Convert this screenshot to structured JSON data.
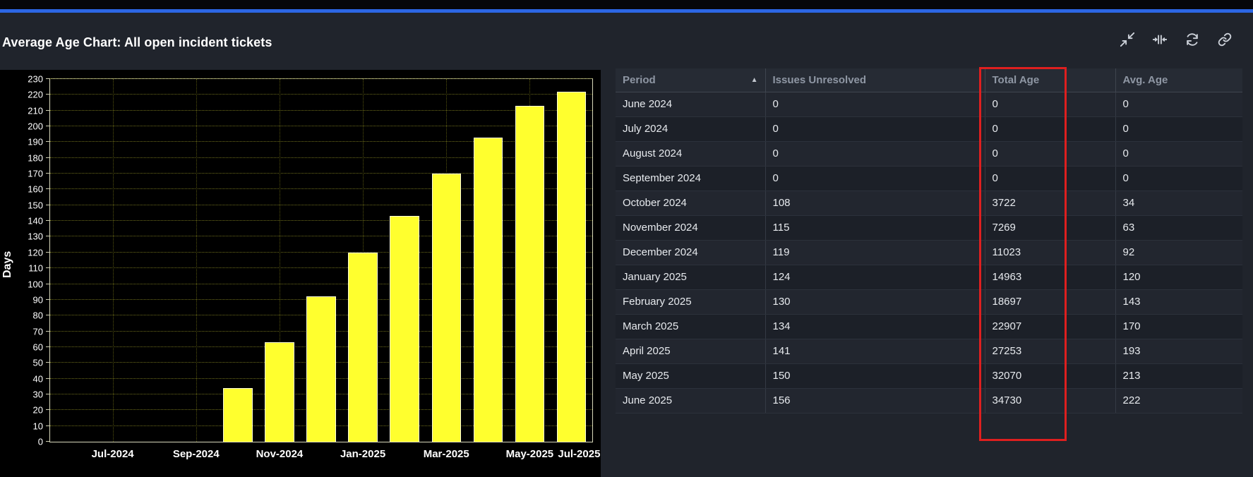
{
  "widget": {
    "title": "Average Age Chart: All open incident tickets"
  },
  "toolbar": {
    "buttons": [
      {
        "name": "collapse-icon",
        "action": "Collapse"
      },
      {
        "name": "fit-width-icon",
        "action": "Fit width"
      },
      {
        "name": "refresh-icon",
        "action": "Refresh"
      },
      {
        "name": "link-icon",
        "action": "Link"
      }
    ]
  },
  "chart_data": {
    "type": "bar",
    "title": "Average Age Chart: All open incident tickets",
    "xlabel": "",
    "ylabel": "Days",
    "ylim": [
      0,
      230
    ],
    "y_tick_step": 10,
    "categories": [
      "June 2024",
      "July 2024",
      "August 2024",
      "September 2024",
      "October 2024",
      "November 2024",
      "December 2024",
      "January 2025",
      "February 2025",
      "March 2025",
      "April 2025",
      "May 2025",
      "June 2025"
    ],
    "values": [
      0,
      0,
      0,
      0,
      34,
      63,
      92,
      120,
      143,
      170,
      193,
      213,
      222
    ],
    "x_tick_labels": [
      "Jul-2024",
      "Sep-2024",
      "Nov-2024",
      "Jan-2025",
      "Mar-2025",
      "May-2025",
      "Jul-2025"
    ],
    "series_name": "Avg. Age",
    "grid": true,
    "bar_color": "#ffff2e",
    "plot_bg": "#000000",
    "legend": "none"
  },
  "table": {
    "columns": [
      "Period",
      "Issues Unresolved",
      "Total Age",
      "Avg. Age"
    ],
    "sort": {
      "column": "Period",
      "direction": "asc",
      "indicator": "▲"
    },
    "rows": [
      [
        "June 2024",
        0,
        0,
        0
      ],
      [
        "July 2024",
        0,
        0,
        0
      ],
      [
        "August 2024",
        0,
        0,
        0
      ],
      [
        "September 2024",
        0,
        0,
        0
      ],
      [
        "October 2024",
        108,
        3722,
        34
      ],
      [
        "November 2024",
        115,
        7269,
        63
      ],
      [
        "December 2024",
        119,
        11023,
        92
      ],
      [
        "January 2025",
        124,
        14963,
        120
      ],
      [
        "February 2025",
        130,
        18697,
        143
      ],
      [
        "March 2025",
        134,
        22907,
        170
      ],
      [
        "April 2025",
        141,
        27253,
        193
      ],
      [
        "May 2025",
        150,
        32070,
        213
      ],
      [
        "June 2025",
        156,
        34730,
        222
      ]
    ]
  },
  "annotation": {
    "shape": "rectangle",
    "color": "#de1f1f",
    "highlighted_column": "Total Age"
  },
  "colors": {
    "accent_blue": "#2c66e4",
    "page_bg": "#20242c",
    "chart_bg": "#000000",
    "bar_yellow": "#ffff2e",
    "annotation_red": "#de1f1f"
  }
}
